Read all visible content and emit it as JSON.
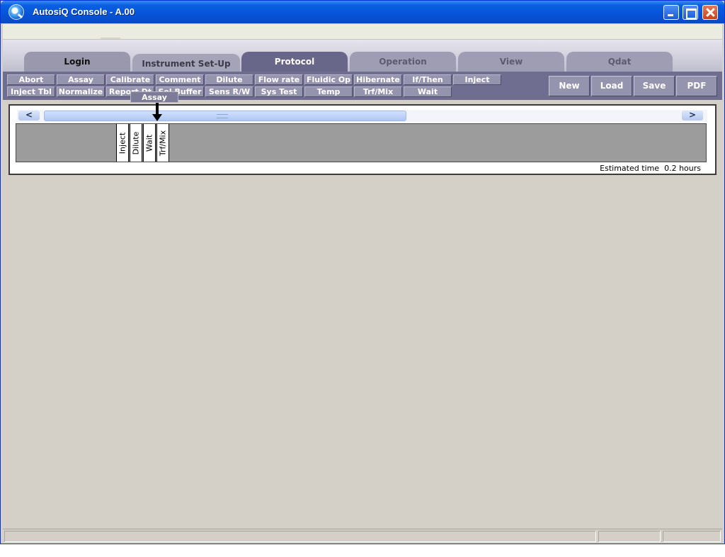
{
  "window": {
    "title": "AutosiQ Console - A.00"
  },
  "tabs": [
    {
      "label": "Login"
    },
    {
      "label": "Instrument Set-Up"
    },
    {
      "label": "Protocol"
    },
    {
      "label": "Operation"
    },
    {
      "label": "View"
    },
    {
      "label": "Qdat"
    }
  ],
  "active_tab": "Protocol",
  "toolbar": {
    "row1": [
      "Abort",
      "Assay",
      "Calibrate",
      "Comment",
      "Dilute",
      "Flow rate",
      "Fluidic Op",
      "Hibernate",
      "If/Then",
      "Inject"
    ],
    "row2": [
      "Inject Tbl",
      "Normalize",
      "Report Dt",
      "Sel Buffer",
      "Sens R/W",
      "Sys Test",
      "Temp",
      "Trf/Mix",
      "Wait"
    ],
    "actions": {
      "new": "New",
      "load": "Load",
      "save": "Save",
      "pdf": "PDF"
    }
  },
  "drag": {
    "label": "Assay"
  },
  "timeline": {
    "steps": [
      "Inject",
      "Dilute",
      "Wait",
      "Trf/Mix"
    ],
    "scroll_left": "<",
    "scroll_right": ">",
    "estimated_label": "Estimated time",
    "estimated_value": "0.2 hours"
  },
  "colors": {
    "titlebar": "#0554d9",
    "toolbar": "#6f6e90",
    "active_tab": "#68678a",
    "workspace": "#d4d0c8"
  }
}
